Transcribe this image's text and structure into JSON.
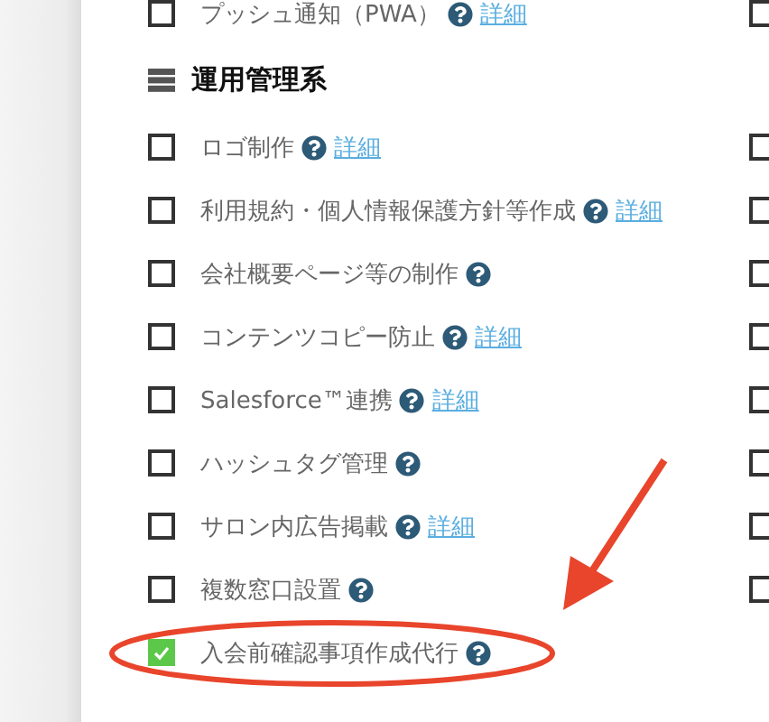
{
  "top_item": {
    "label": "プッシュ通知（PWA）",
    "checked": false,
    "detail_link": "詳細",
    "right_checkbox": {
      "checked": false
    }
  },
  "section": {
    "title": "運用管理系",
    "items": [
      {
        "label": "ロゴ制作",
        "checked": false,
        "detail_link": "詳細",
        "highlighted": false,
        "right_checkbox": {
          "checked": false
        }
      },
      {
        "label": "利用規約・個人情報保護方針等作成",
        "checked": false,
        "detail_link": "詳細",
        "highlighted": false,
        "right_checkbox": {
          "checked": false
        }
      },
      {
        "label": "会社概要ページ等の制作",
        "checked": false,
        "highlighted": false,
        "right_checkbox": {
          "checked": false
        }
      },
      {
        "label": "コンテンツコピー防止",
        "checked": false,
        "detail_link": "詳細",
        "highlighted": false,
        "right_checkbox": {
          "checked": false
        }
      },
      {
        "label": "Salesforce™連携",
        "checked": false,
        "detail_link": "詳細",
        "highlighted": false,
        "right_checkbox": {
          "checked": false
        }
      },
      {
        "label": "ハッシュタグ管理",
        "checked": false,
        "highlighted": false,
        "right_checkbox": {
          "checked": false
        }
      },
      {
        "label": "サロン内広告掲載",
        "checked": false,
        "detail_link": "詳細",
        "highlighted": false,
        "right_checkbox": {
          "checked": false
        }
      },
      {
        "label": "複数窓口設置",
        "checked": false,
        "highlighted": false,
        "right_checkbox": {
          "checked": false
        }
      },
      {
        "label": "入会前確認事項作成代行",
        "checked": true,
        "highlighted": true
      }
    ]
  }
}
